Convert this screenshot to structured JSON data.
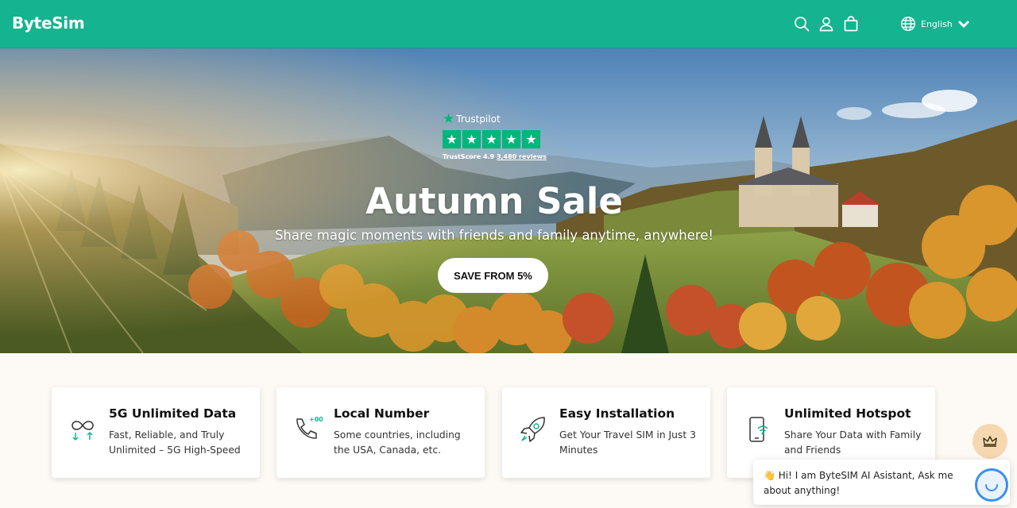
{
  "header": {
    "brand": "ByteSim",
    "language": "English",
    "bg_color": "#13b48f",
    "icons": [
      "search-icon",
      "user-icon",
      "cart-icon",
      "globe-icon",
      "chevron-down-icon"
    ]
  },
  "hero": {
    "trustpilot": {
      "name": "Trustpilot",
      "score_label": "TrustScore 4.9",
      "reviews_label": "3,480 reviews",
      "stars": 5,
      "star_color": "#00b67a"
    },
    "title": "Autumn Sale",
    "subtitle": "Share magic moments with friends and family anytime, anywhere!",
    "cta": "SAVE FROM 5%"
  },
  "features": [
    {
      "icon": "infinity-icon",
      "title": "5G Unlimited Data",
      "desc": "Fast, Reliable, and Truly Unlimited – 5G High-Speed"
    },
    {
      "icon": "phone-plus-icon",
      "title": "Local Number",
      "desc": "Some countries, including the USA, Canada, etc."
    },
    {
      "icon": "rocket-icon",
      "title": "Easy Installation",
      "desc": "Get Your Travel SIM in Just 3 Minutes"
    },
    {
      "icon": "hotspot-phone-icon",
      "title": "Unlimited Hotspot",
      "desc": "Share Your Data with Family and Friends"
    }
  ],
  "chat": {
    "message": "👋 Hi! I am ByteSIM AI Asistant, Ask me about anything!",
    "launcher_icon": "crown-icon",
    "avatar_icon": "assistant-face-icon"
  }
}
